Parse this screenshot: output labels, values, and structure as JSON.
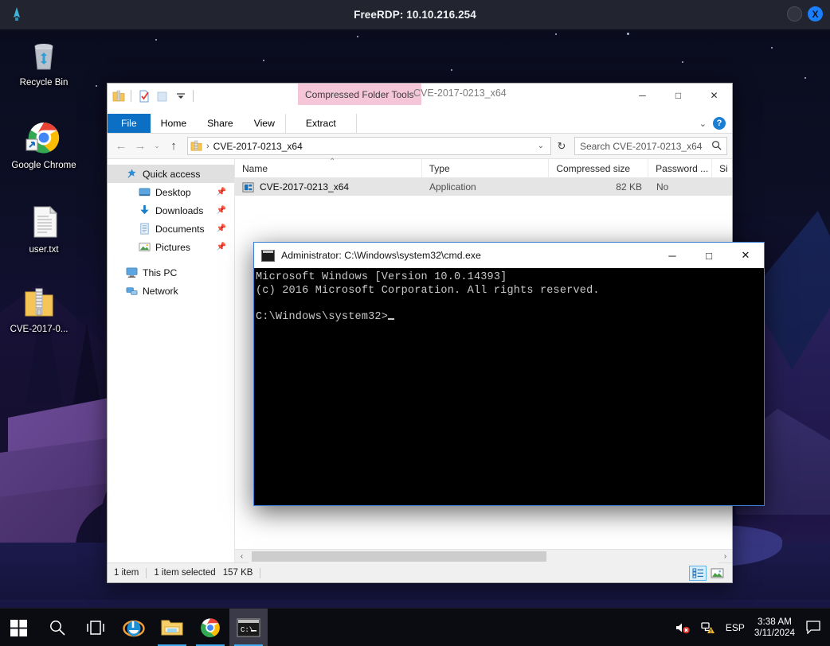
{
  "rdp": {
    "title": "FreeRDP: 10.10.216.254",
    "app_icon": "freerdp-icon",
    "minimize_label": "",
    "close_label": "X"
  },
  "desktop": {
    "icons": [
      {
        "name": "recycle-bin",
        "label": "Recycle Bin"
      },
      {
        "name": "google-chrome",
        "label": "Google Chrome"
      },
      {
        "name": "user-txt",
        "label": "user.txt"
      },
      {
        "name": "cve-zip",
        "label": "CVE-2017-0..."
      }
    ]
  },
  "explorer": {
    "window_title": "CVE-2017-0213_x64",
    "contextual_tab": "Compressed Folder Tools",
    "quick_access_toolbar": [
      {
        "name": "zip-folder-icon"
      },
      {
        "name": "properties-icon"
      },
      {
        "name": "new-folder-icon"
      },
      {
        "name": "customize-chevron-icon"
      }
    ],
    "window_buttons": {
      "minimize": "─",
      "maximize": "□",
      "close": "✕"
    },
    "tabs": [
      {
        "name": "file",
        "label": "File"
      },
      {
        "name": "home",
        "label": "Home"
      },
      {
        "name": "share",
        "label": "Share"
      },
      {
        "name": "view",
        "label": "View"
      },
      {
        "name": "extract",
        "label": "Extract"
      }
    ],
    "ribbon_collapse": "⌄",
    "ribbon_help": "?",
    "nav": {
      "back": "←",
      "forward": "→",
      "recent": "⌄",
      "up": "↑",
      "separator": "›",
      "path": "CVE-2017-0213_x64",
      "chevron": "⌄",
      "refresh": "↻"
    },
    "search": {
      "placeholder": "Search CVE-2017-0213_x64",
      "icon": "search-icon"
    },
    "sidebar": {
      "items": [
        {
          "name": "quick-access",
          "label": "Quick access",
          "icon": "star-pin-icon",
          "selected": true,
          "child": false,
          "pinned": false
        },
        {
          "name": "desktop",
          "label": "Desktop",
          "icon": "desktop-icon",
          "selected": false,
          "child": true,
          "pinned": true
        },
        {
          "name": "downloads",
          "label": "Downloads",
          "icon": "downloads-icon",
          "selected": false,
          "child": true,
          "pinned": true
        },
        {
          "name": "documents",
          "label": "Documents",
          "icon": "documents-icon",
          "selected": false,
          "child": true,
          "pinned": true
        },
        {
          "name": "pictures",
          "label": "Pictures",
          "icon": "pictures-icon",
          "selected": false,
          "child": true,
          "pinned": true
        },
        {
          "name": "this-pc",
          "label": "This PC",
          "icon": "this-pc-icon",
          "selected": false,
          "child": false,
          "pinned": false
        },
        {
          "name": "network",
          "label": "Network",
          "icon": "network-icon",
          "selected": false,
          "child": false,
          "pinned": false
        }
      ]
    },
    "columns": [
      {
        "name": "name",
        "label": "Name"
      },
      {
        "name": "type",
        "label": "Type"
      },
      {
        "name": "compressed-size",
        "label": "Compressed size"
      },
      {
        "name": "password-protected",
        "label": "Password ..."
      },
      {
        "name": "size",
        "label": "Si"
      }
    ],
    "sort_indicator": "⌃",
    "files": [
      {
        "name": "CVE-2017-0213_x64",
        "type": "Application",
        "compressed_size": "82 KB",
        "password": "No",
        "selected": true
      }
    ],
    "status": {
      "item_count": "1 item",
      "selection": "1 item selected",
      "selection_size": "157 KB",
      "views": [
        {
          "name": "details-view",
          "selected": true
        },
        {
          "name": "large-icons-view",
          "selected": false
        }
      ]
    },
    "hscroll": {
      "left_arrow": "‹",
      "right_arrow": "›"
    }
  },
  "cmd": {
    "title": "Administrator: C:\\Windows\\system32\\cmd.exe",
    "icon": "cmd-icon",
    "window_buttons": {
      "minimize": "─",
      "maximize": "□",
      "close": "✕"
    },
    "lines": [
      "Microsoft Windows [Version 10.0.14393]",
      "(c) 2016 Microsoft Corporation. All rights reserved.",
      "",
      "C:\\Windows\\system32>"
    ]
  },
  "taskbar": {
    "buttons": [
      {
        "name": "start-button",
        "icon": "windows-logo-icon"
      },
      {
        "name": "search-button",
        "icon": "search-icon"
      },
      {
        "name": "task-view-button",
        "icon": "task-view-icon"
      },
      {
        "name": "internet-explorer-button",
        "icon": "internet-explorer-icon",
        "running": false
      },
      {
        "name": "file-explorer-button",
        "icon": "file-explorer-icon",
        "running": true
      },
      {
        "name": "chrome-button",
        "icon": "chrome-icon",
        "running": true
      },
      {
        "name": "cmd-button",
        "icon": "cmd-icon",
        "running": true,
        "active": true
      }
    ],
    "tray": {
      "volume_icon": "volume-muted-icon",
      "network_icon": "network-warning-icon",
      "language": "ESP",
      "time": "3:38 AM",
      "date": "3/11/2024",
      "action_center_icon": "action-center-icon"
    }
  },
  "colors": {
    "accent_blue": "#0b6fc4",
    "contextual_tab_pink": "#f5c6d8",
    "rdp_close_blue": "#1a7fff",
    "selection_gray": "#e5e5e5",
    "taskbar_dark": "#0b0b12"
  }
}
